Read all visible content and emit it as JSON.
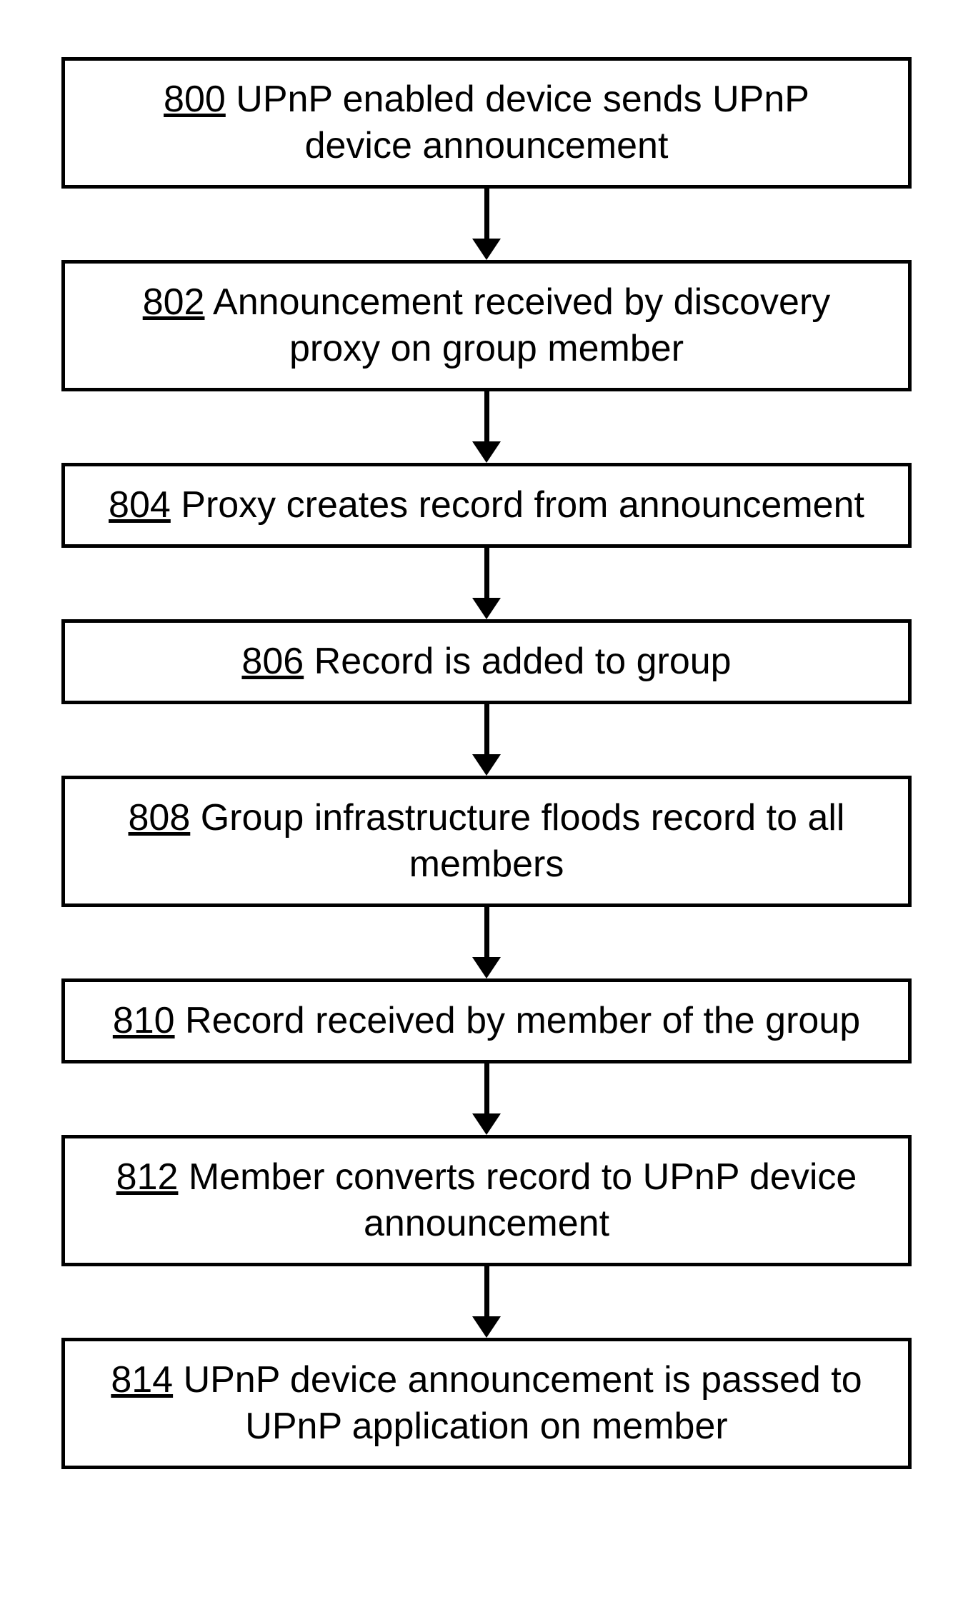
{
  "chart_data": {
    "type": "flowchart",
    "title": "",
    "direction": "top-to-bottom",
    "nodes": [
      {
        "id": "800",
        "text": "UPnP enabled device sends UPnP device announcement"
      },
      {
        "id": "802",
        "text": "Announcement received by discovery proxy on group member"
      },
      {
        "id": "804",
        "text": "Proxy creates record from announcement"
      },
      {
        "id": "806",
        "text": "Record is added to group"
      },
      {
        "id": "808",
        "text": "Group infrastructure floods record to all members"
      },
      {
        "id": "810",
        "text": "Record received by member of the group"
      },
      {
        "id": "812",
        "text": "Member converts record to UPnP device announcement"
      },
      {
        "id": "814",
        "text": "UPnP device announcement is passed to UPnP application on member"
      }
    ],
    "edges": [
      {
        "from": "800",
        "to": "802"
      },
      {
        "from": "802",
        "to": "804"
      },
      {
        "from": "804",
        "to": "806"
      },
      {
        "from": "806",
        "to": "808"
      },
      {
        "from": "808",
        "to": "810"
      },
      {
        "from": "810",
        "to": "812"
      },
      {
        "from": "812",
        "to": "814"
      }
    ]
  }
}
